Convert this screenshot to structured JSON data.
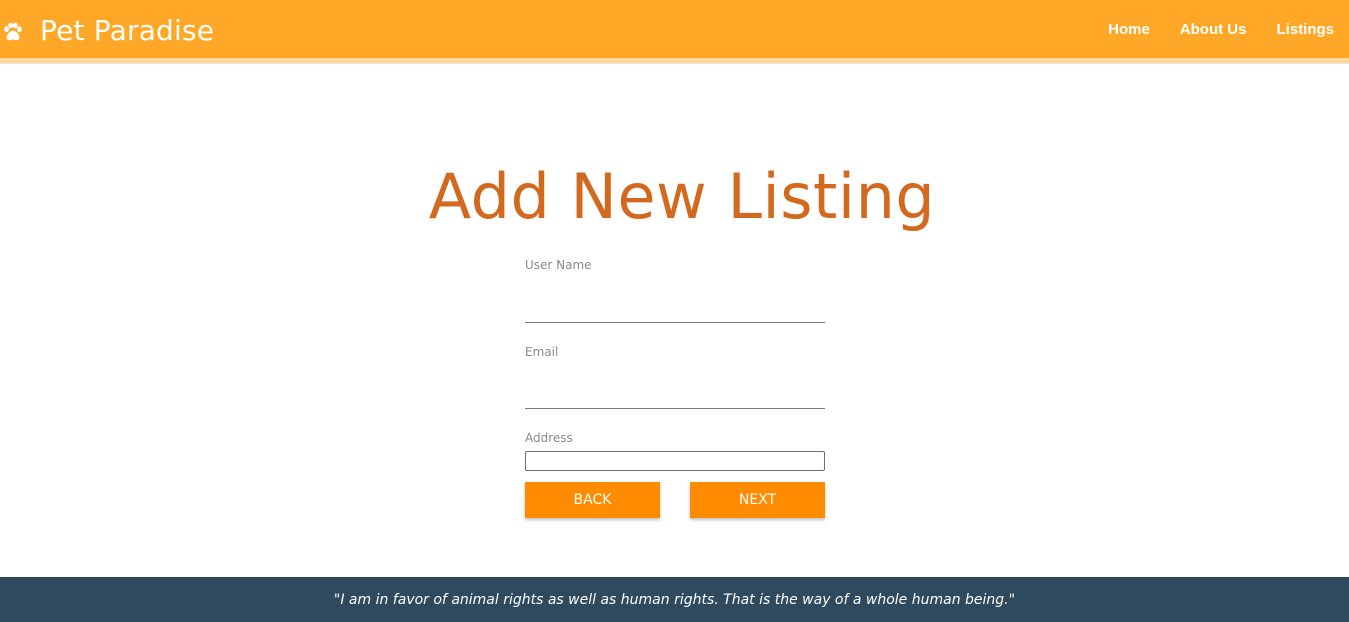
{
  "header": {
    "brand": "Pet Paradise",
    "brand_icon": "paw-icon",
    "nav": [
      "Home",
      "About Us",
      "Listings"
    ]
  },
  "page": {
    "title": "Add New Listing"
  },
  "form": {
    "username": {
      "label": "User Name",
      "value": ""
    },
    "email": {
      "label": "Email",
      "value": ""
    },
    "address": {
      "label": "Address",
      "value": ""
    },
    "back_label": "BACK",
    "next_label": "NEXT"
  },
  "footer": {
    "quote": "\"I am in favor of animal rights as well as human rights. That is the way of a whole human being.\""
  },
  "colors": {
    "header_bg": "#ffa726",
    "title": "#d2691e",
    "button": "#ff8c00",
    "footer_bg": "#2f4a5f"
  }
}
